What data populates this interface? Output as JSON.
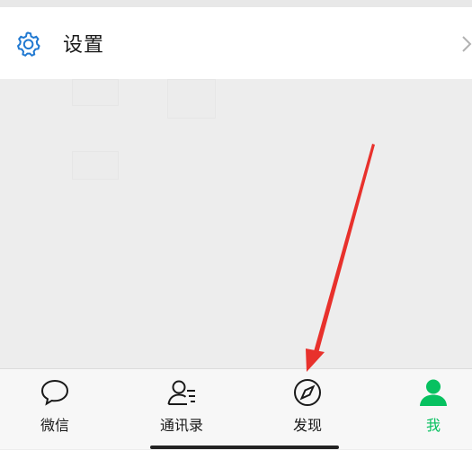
{
  "settings": {
    "label": "设置",
    "icon": "gear-icon",
    "chevron_icon": "chevron-right-icon",
    "icon_color": "#1f78d1"
  },
  "tabbar": {
    "tabs": [
      {
        "label": "微信",
        "icon": "chat-bubble-icon",
        "active": false
      },
      {
        "label": "通讯录",
        "icon": "contacts-icon",
        "active": false
      },
      {
        "label": "发现",
        "icon": "compass-icon",
        "active": false
      },
      {
        "label": "我",
        "icon": "person-icon",
        "active": true
      }
    ],
    "active_color": "#07c160"
  },
  "annotation": {
    "type": "red-arrow",
    "points_to": "发现",
    "color": "#e8312c"
  }
}
